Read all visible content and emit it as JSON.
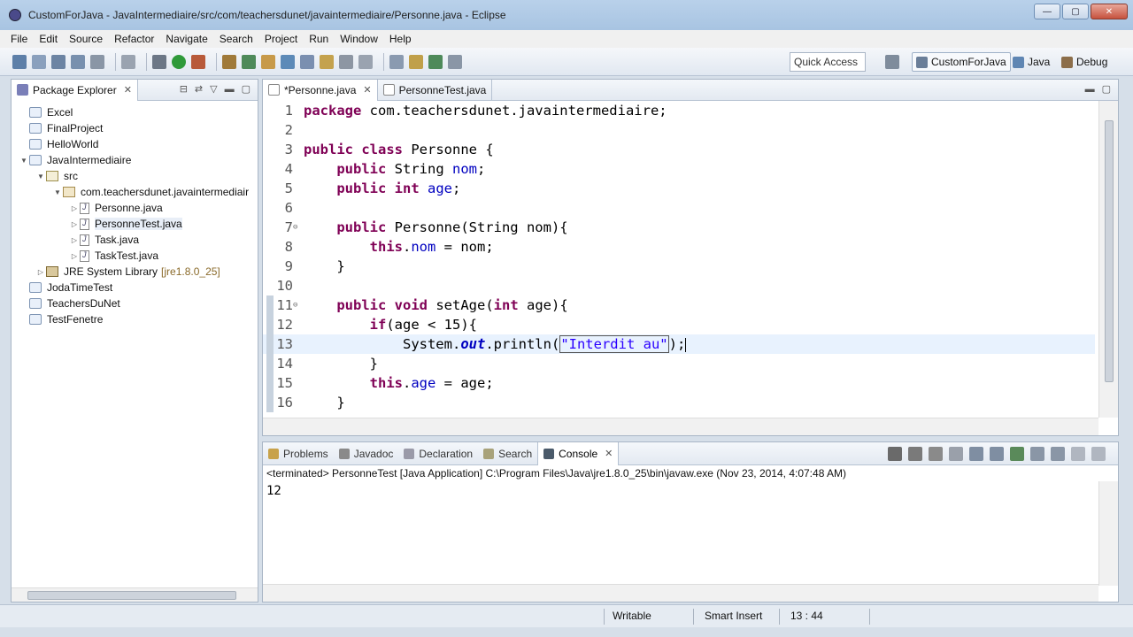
{
  "window": {
    "title": "CustomForJava - JavaIntermediaire/src/com/teachersdunet/javaintermediaire/Personne.java - Eclipse",
    "controls": [
      "—",
      "▢",
      "✕"
    ]
  },
  "menu": [
    "File",
    "Edit",
    "Source",
    "Refactor",
    "Navigate",
    "Search",
    "Project",
    "Run",
    "Window",
    "Help"
  ],
  "toolbar": {
    "quick_access": "Quick Access",
    "perspectives": [
      "CustomForJava",
      "Java",
      "Debug"
    ]
  },
  "package_explorer": {
    "title": "Package Explorer",
    "items": [
      {
        "label": "Excel",
        "level": 0,
        "kind": "project",
        "twisty": ""
      },
      {
        "label": "FinalProject",
        "level": 0,
        "kind": "project",
        "twisty": ""
      },
      {
        "label": "HelloWorld",
        "level": 0,
        "kind": "project",
        "twisty": ""
      },
      {
        "label": "JavaIntermediaire",
        "level": 0,
        "kind": "project",
        "twisty": "▼"
      },
      {
        "label": "src",
        "level": 1,
        "kind": "src",
        "twisty": "▼"
      },
      {
        "label": "com.teachersdunet.javaintermediair",
        "level": 2,
        "kind": "package",
        "twisty": "▼"
      },
      {
        "label": "Personne.java",
        "level": 3,
        "kind": "java",
        "twisty": "▷"
      },
      {
        "label": "PersonneTest.java",
        "level": 3,
        "kind": "java",
        "twisty": "▷",
        "selected": true
      },
      {
        "label": "Task.java",
        "level": 3,
        "kind": "java",
        "twisty": "▷"
      },
      {
        "label": "TaskTest.java",
        "level": 3,
        "kind": "java",
        "twisty": "▷"
      },
      {
        "label": "JRE System Library",
        "suffix": "[jre1.8.0_25]",
        "level": 1,
        "kind": "lib",
        "twisty": "▷"
      },
      {
        "label": "JodaTimeTest",
        "level": 0,
        "kind": "project",
        "twisty": ""
      },
      {
        "label": "TeachersDuNet",
        "level": 0,
        "kind": "project",
        "twisty": ""
      },
      {
        "label": "TestFenetre",
        "level": 0,
        "kind": "project",
        "twisty": ""
      }
    ]
  },
  "editor": {
    "tabs": [
      {
        "label": "*Personne.java",
        "active": true,
        "closable": "✕"
      },
      {
        "label": "PersonneTest.java",
        "active": false
      }
    ],
    "lines": [
      {
        "n": "1",
        "tokens": [
          [
            "kw",
            "package"
          ],
          [
            "",
            " com.teachersdunet.javaintermediaire;"
          ]
        ]
      },
      {
        "n": "2",
        "tokens": []
      },
      {
        "n": "3",
        "tokens": [
          [
            "kw",
            "public"
          ],
          [
            "",
            " "
          ],
          [
            "kw",
            "class"
          ],
          [
            "",
            " Personne {"
          ]
        ]
      },
      {
        "n": "4",
        "tokens": [
          [
            "",
            "    "
          ],
          [
            "kw",
            "public"
          ],
          [
            "",
            " String "
          ],
          [
            "fld",
            "nom"
          ],
          [
            "",
            ";"
          ]
        ]
      },
      {
        "n": "5",
        "tokens": [
          [
            "",
            "    "
          ],
          [
            "kw",
            "public"
          ],
          [
            "",
            " "
          ],
          [
            "kw",
            "int"
          ],
          [
            "",
            " "
          ],
          [
            "fld",
            "age"
          ],
          [
            "",
            ";"
          ]
        ]
      },
      {
        "n": "6",
        "tokens": []
      },
      {
        "n": "7",
        "fold": "⊖",
        "tokens": [
          [
            "",
            "    "
          ],
          [
            "kw",
            "public"
          ],
          [
            "",
            " Personne(String nom){"
          ]
        ]
      },
      {
        "n": "8",
        "tokens": [
          [
            "",
            "        "
          ],
          [
            "kw",
            "this"
          ],
          [
            "",
            "."
          ],
          [
            "fld",
            "nom"
          ],
          [
            "",
            " = nom;"
          ]
        ]
      },
      {
        "n": "9",
        "tokens": [
          [
            "",
            "    }"
          ]
        ]
      },
      {
        "n": "10",
        "tokens": []
      },
      {
        "n": "11",
        "fold": "⊖",
        "changed": true,
        "tokens": [
          [
            "",
            "    "
          ],
          [
            "kw",
            "public"
          ],
          [
            "",
            " "
          ],
          [
            "kw",
            "void"
          ],
          [
            "",
            " setAge("
          ],
          [
            "kw",
            "int"
          ],
          [
            "",
            " age){"
          ]
        ]
      },
      {
        "n": "12",
        "changed": true,
        "tokens": [
          [
            "",
            "        "
          ],
          [
            "kw",
            "if"
          ],
          [
            "",
            "(age < 15){"
          ]
        ]
      },
      {
        "n": "13",
        "changed": true,
        "current": true,
        "tokens": [
          [
            "",
            "            System."
          ],
          [
            "sfld",
            "out"
          ],
          [
            "",
            ".println("
          ],
          [
            "strbox",
            "\"Interdit au\""
          ],
          [
            "",
            ");"
          ]
        ]
      },
      {
        "n": "14",
        "changed": true,
        "tokens": [
          [
            "",
            "        }"
          ]
        ]
      },
      {
        "n": "15",
        "changed": true,
        "tokens": [
          [
            "",
            "        "
          ],
          [
            "kw",
            "this"
          ],
          [
            "",
            "."
          ],
          [
            "fld",
            "age"
          ],
          [
            "",
            " = age;"
          ]
        ]
      },
      {
        "n": "16",
        "changed": true,
        "tokens": [
          [
            "",
            "    }"
          ]
        ]
      }
    ]
  },
  "console": {
    "tabs": [
      "Problems",
      "Javadoc",
      "Declaration",
      "Search",
      "Console"
    ],
    "active_tab": "Console",
    "terminated": "<terminated> PersonneTest [Java Application] C:\\Program Files\\Java\\jre1.8.0_25\\bin\\javaw.exe (Nov 23, 2014, 4:07:48 AM)",
    "output": "12"
  },
  "status": {
    "writable": "Writable",
    "insert_mode": "Smart Insert",
    "position": "13 : 44"
  }
}
